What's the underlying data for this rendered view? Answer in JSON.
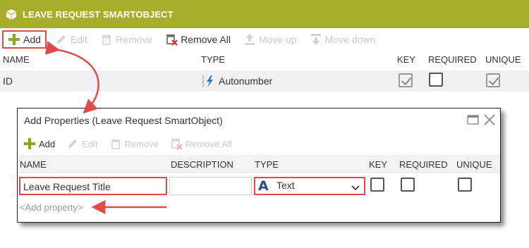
{
  "header": {
    "title": "LEAVE REQUEST SMARTOBJECT",
    "icon": "cube-icon",
    "color": "#a8ad2b"
  },
  "toolbar": {
    "add": "Add",
    "edit": "Edit",
    "remove": "Remove",
    "remove_all": "Remove All",
    "move_up": "Move up",
    "move_down": "Move down"
  },
  "grid": {
    "columns": {
      "name": "NAME",
      "type": "TYPE",
      "key": "KEY",
      "required": "REQUIRED",
      "unique": "UNIQUE"
    },
    "rows": [
      {
        "name": "ID",
        "type": "Autonumber",
        "type_icon": "autonumber-icon",
        "key": true,
        "required": false,
        "unique": true
      }
    ]
  },
  "dialog": {
    "title": "Add Properties (Leave Request SmartObject)",
    "toolbar": {
      "add": "Add",
      "edit": "Edit",
      "remove": "Remove",
      "remove_all": "Remove All"
    },
    "columns": {
      "name": "NAME",
      "description": "DESCRIPTION",
      "type": "TYPE",
      "key": "KEY",
      "required": "REQUIRED",
      "unique": "UNIQUE"
    },
    "row": {
      "name": "Leave Request Title",
      "description": "",
      "type": "Text",
      "type_icon": "text-type-icon",
      "key": false,
      "required": false,
      "unique": false
    },
    "add_property": "<Add property>"
  },
  "colors": {
    "highlight": "#e04a4a",
    "accent": "#a8ad2b"
  }
}
